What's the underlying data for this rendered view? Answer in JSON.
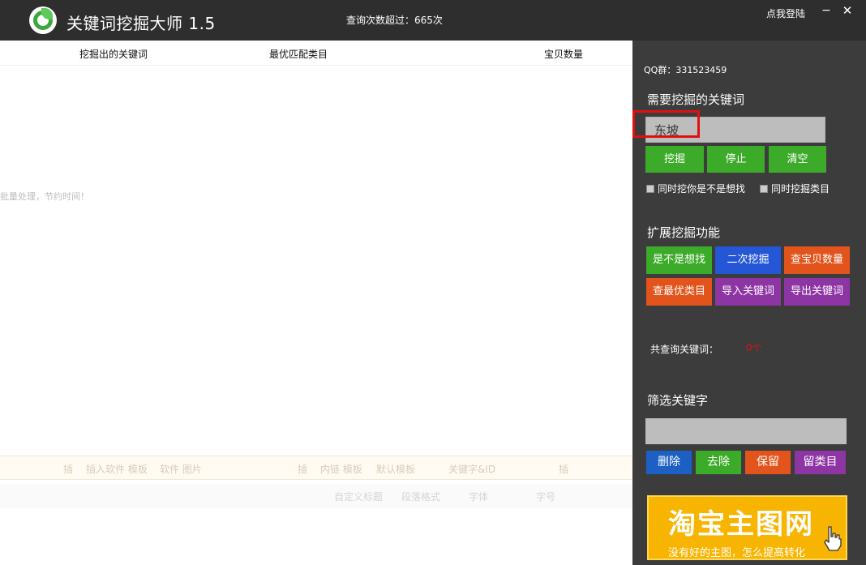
{
  "title_bar": {
    "app_title": "关键词挖掘大师 1.5",
    "query_count": "查询次数超过：665次",
    "login_label": "点我登陆",
    "minimize_label": "−",
    "close_label": "✕"
  },
  "results_table": {
    "columns": [
      "挖掘出的关键词",
      "最优匹配类目",
      "宝贝数量"
    ]
  },
  "background": {
    "note": "批量处理，节约时间！",
    "bar1": [
      "插",
      "插入软件 模板",
      "软件 图片",
      "插",
      "内链 模板",
      "默认模板",
      "关键字&ID",
      "插"
    ],
    "bar2": [
      "自定义标题",
      "段落格式",
      "字体",
      "字号"
    ]
  },
  "panel": {
    "qq_group": "QQ群：331523459",
    "mine_section_title": "需要挖掘的关键词",
    "keyword_value": "东坡",
    "buttons": {
      "mine": "挖掘",
      "stop": "停止",
      "clear": "清空"
    },
    "checkbox_guess": "同时挖你是不是想找",
    "checkbox_category": "同时挖掘类目",
    "extend_section_title": "扩展挖掘功能",
    "extend_buttons": [
      "是不是想找",
      "二次挖掘",
      "查宝贝数量",
      "查最优类目",
      "导入关键词",
      "导出关键词"
    ],
    "total_label": "共查询关键词：",
    "total_value": "0个",
    "filter_section_title": "筛选关键字",
    "filter_buttons": [
      "删除",
      "去除",
      "保留",
      "留类目"
    ],
    "banner_title": "淘宝主图网",
    "banner_subtitle": "没有好的主图，怎么提高转化"
  },
  "colors": {
    "green": "#3dab2a",
    "blue": "#2456d6",
    "orange": "#e2541c",
    "purple": "#8e35a4",
    "highlight_red": "#e01010",
    "banner_yellow": "#f7b400"
  }
}
